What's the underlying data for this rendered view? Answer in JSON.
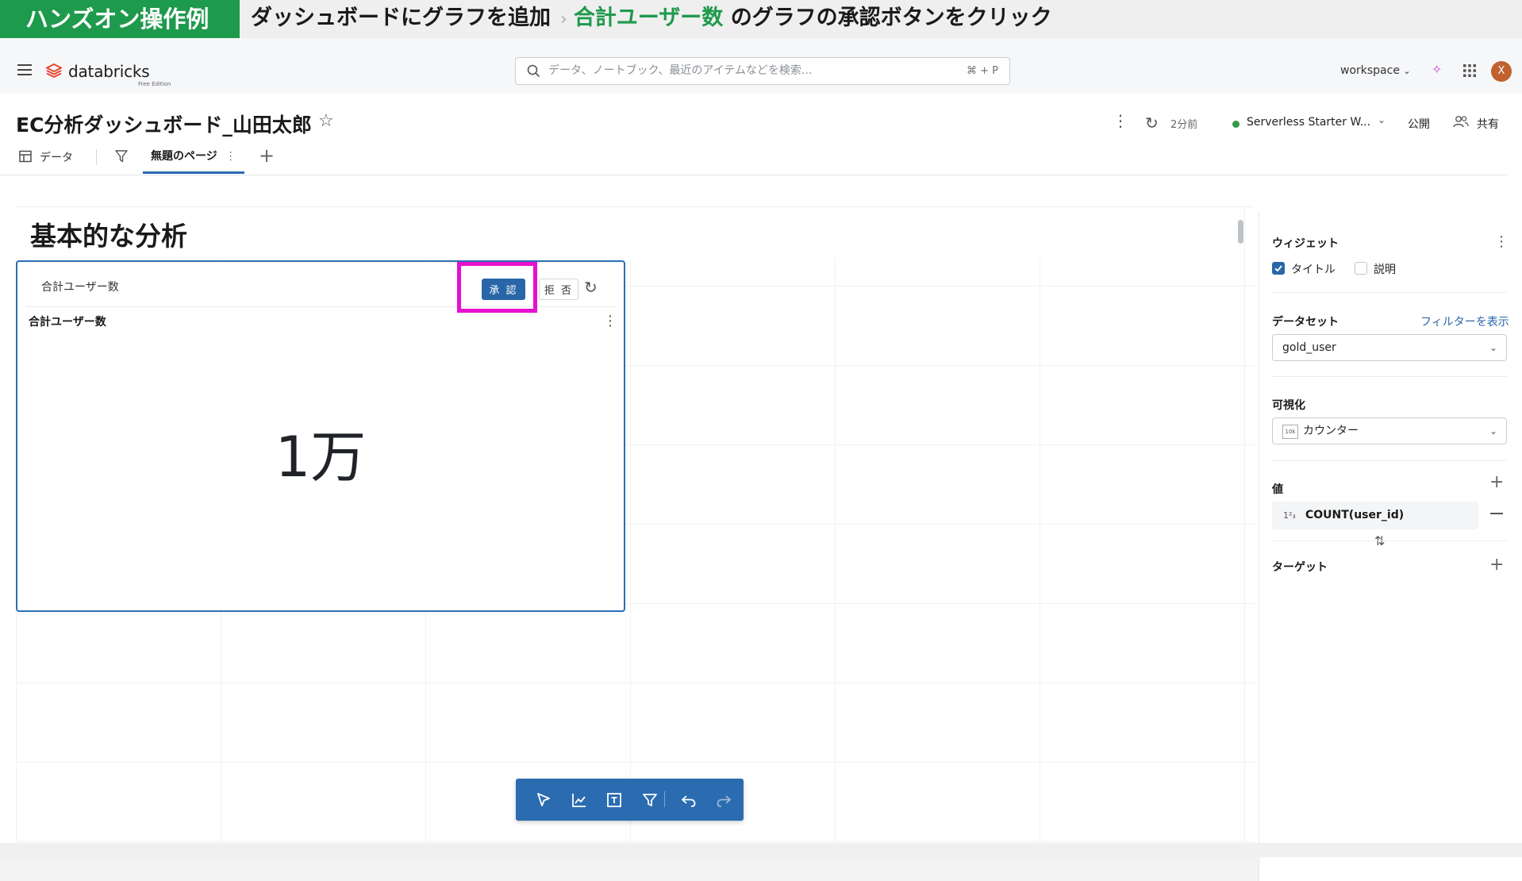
{
  "banner": {
    "tag": "ハンズオン操作例",
    "step": "ダッシュボードにグラフを追加",
    "separator": "›",
    "highlight": "合計ユーザー数",
    "instruction": "のグラフの承認ボタンをクリック"
  },
  "topbar": {
    "logo_text": "databricks",
    "logo_sub": "Free Edition",
    "search_placeholder": "データ、ノートブック、最近のアイテムなどを検索...",
    "search_shortcut": "⌘ + P",
    "workspace_label": "workspace",
    "avatar_initial": "X"
  },
  "header": {
    "title": "EC分析ダッシュボード_山田太郎",
    "refresh_time": "2分前",
    "warehouse": "Serverless Starter W...",
    "warehouse_status_color": "#2f9a48",
    "publish": "公開",
    "share": "共有"
  },
  "tabs": {
    "data": "データ",
    "page": "無題のページ"
  },
  "canvas": {
    "section_title": "基本的な分析"
  },
  "widget": {
    "suggestion_text": "合計ユーザー数",
    "approve_label": "承 認",
    "reject_label": "拒 否",
    "title": "合計ユーザー数",
    "value": "1万",
    "highlight_color": "#e70fd0"
  },
  "panel": {
    "widget_heading": "ウィジェット",
    "title_checkbox": "タイトル",
    "title_checked": true,
    "desc_checkbox": "説明",
    "desc_checked": false,
    "dataset_heading": "データセット",
    "show_filter_link": "フィルターを表示",
    "dataset_value": "gold_user",
    "viz_heading": "可視化",
    "viz_icon_text": "10k",
    "viz_value": "カウンター",
    "value_heading": "値",
    "value_field": "COUNT(user_id)",
    "value_field_icon": "1²₃",
    "target_heading": "ターゲット"
  },
  "colors": {
    "accent": "#2866a8",
    "banner_green": "#1e9a4c"
  }
}
